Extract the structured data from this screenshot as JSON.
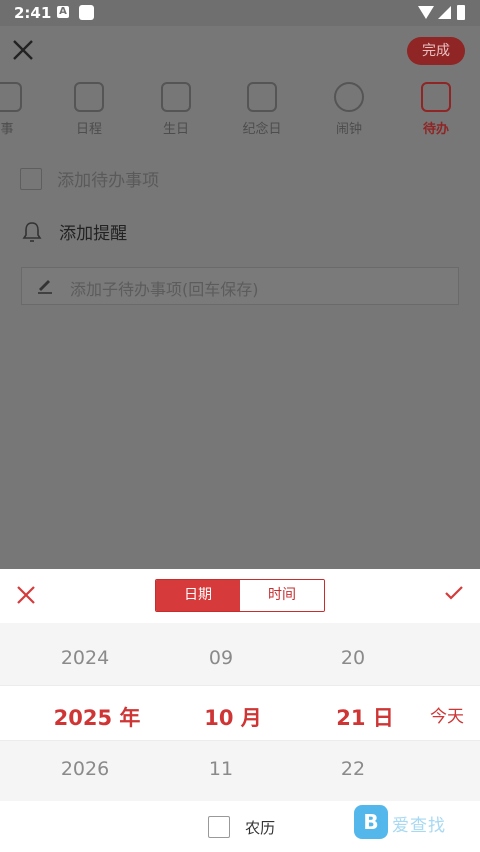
{
  "status": {
    "time": "2:41",
    "a_icon": "A"
  },
  "header": {
    "done_label": "完成"
  },
  "tabs": [
    {
      "label": "事",
      "icon": "memo-icon"
    },
    {
      "label": "日程",
      "icon": "schedule-icon"
    },
    {
      "label": "生日",
      "icon": "gift-icon"
    },
    {
      "label": "纪念日",
      "icon": "anniversary-icon"
    },
    {
      "label": "闹钟",
      "icon": "alarm-icon"
    },
    {
      "label": "待办",
      "icon": "todo-list-icon",
      "active": true
    }
  ],
  "form": {
    "todo_placeholder": "添加待办事项",
    "reminder_label": "添加提醒",
    "subtask_placeholder": "添加子待办事项(回车保存)"
  },
  "picker": {
    "segment_date": "日期",
    "segment_time": "时间",
    "years": [
      "2024",
      "2025 年",
      "2026"
    ],
    "months": [
      "09",
      "10 月",
      "11"
    ],
    "days": [
      "20",
      "21 日",
      "22"
    ],
    "today_label": "今天",
    "lunar_label": "农历"
  },
  "watermark": {
    "logo": "B",
    "text": "爱查找"
  },
  "colors": {
    "accent": "#d63a3a",
    "dim_accent": "#8f2525"
  }
}
